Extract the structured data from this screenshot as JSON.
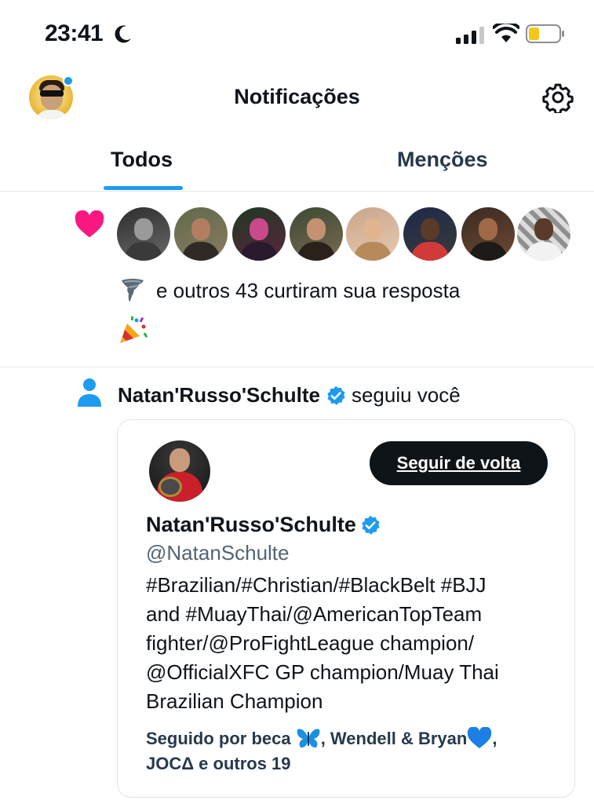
{
  "status_bar": {
    "time": "23:41",
    "icons": [
      "moon-icon",
      "signal-icon",
      "wifi-icon",
      "battery-icon"
    ]
  },
  "header": {
    "title": "Notificações",
    "icons": [
      "avatar",
      "settings-gear-icon"
    ]
  },
  "tabs": [
    {
      "label": "Todos",
      "active": true
    },
    {
      "label": "Menções",
      "active": false
    }
  ],
  "notifications": {
    "like": {
      "icon": "heart-icon",
      "avatar_count": 8,
      "prefix_emoji": "tornado-emoji",
      "text": "e outros 43 curtiram sua resposta",
      "reply_preview_emoji": "party-popper-emoji"
    },
    "follow": {
      "icon": "person-icon",
      "name": "Natan'Russo'Schulte",
      "action": "seguiu você",
      "card": {
        "button_label": "Seguir de volta",
        "name": "Natan'Russo'Schulte",
        "handle": "@NatanSchulte",
        "bio": "#Brazilian/#Christian/#BlackBelt #BJJ\nand #MuayThai/@AmericanTopTeam\nfighter/@ProFightLeague champion/\n@OfficialXFC GP champion/Muay Thai\nBrazilian Champion",
        "followed_by_part1": "Seguido por beca ",
        "followed_by_part2": ", Wendell & Bryan",
        "followed_by_part3": ",",
        "followed_by_part4": "JOCΔ e outros 19"
      }
    }
  },
  "colors": {
    "accent": "#1d9bf0",
    "heart": "#f91880",
    "text": "#0f1419",
    "secondary_text": "#536471"
  }
}
